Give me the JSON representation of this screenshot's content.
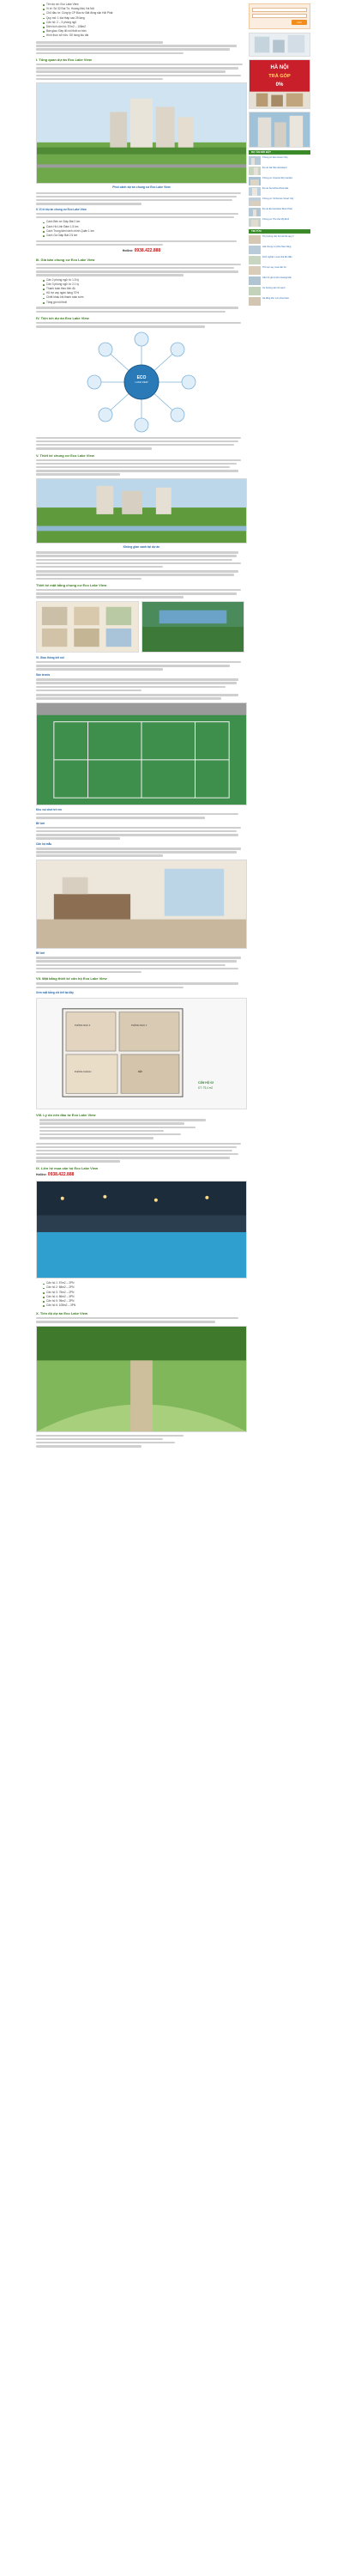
{
  "intro_list": [
    "Tên dự án: Eco Lake View",
    "Vị trí: Số 32 Đại Từ, Hoàng Mai, Hà Nội",
    "Chủ đầu tư: Công ty CP Đầu tư Bất động sản Hải Phát",
    "Quy mô: 1 tòa tháp cao 25 tầng",
    "Căn hộ: 2 – 3 phòng ngủ",
    "Diện tích căn hộ: 57m2 – 108m2",
    "Bàn giao: Đầy đủ nội thất cơ bản",
    "Hình thức sở hữu: Sổ hồng lâu dài"
  ],
  "sec_overview_title": "I. Tổng quan dự án Eco Lake View",
  "img1_caption": "Phối cảnh dự án chung cư Eco Lake View",
  "sec_location_title": "II. Vị trí dự án chung cư Eco Lake View",
  "location_list": [
    "Cách Bến xe Giáp Bát 2 km",
    "Cách Hồ Linh Đàm 1.5 km",
    "Cách Trung tâm hành chính Quận 1 km",
    "Cách Ga Giáp Bát 2.5 km"
  ],
  "hotline": {
    "label": "Hotline:",
    "number": "0938.422.888"
  },
  "sec_price_title": "III. Giá bán chung cư Eco Lake View",
  "price_list": [
    "Căn 2 phòng ngủ: từ 1.5 tỷ",
    "Căn 3 phòng ngủ: từ 2.1 tỷ",
    "Thanh toán theo tiến độ",
    "Hỗ trợ vay ngân hàng 70%",
    "Chiết khấu khi thanh toán sớm",
    "Tặng gói nội thất"
  ],
  "sec_utility_title": "IV. Tiện ích dự án Eco Lake View",
  "eco_center": "ECO",
  "eco_center2": "LAKE VIEW",
  "sec_design_title": "V. Thiết kế chung cư Eco Lake View",
  "img2_caption": "Không gian xanh tại dự án",
  "sec_ground_title": "Thiết kế mặt bằng chung cư Eco Lake View",
  "sec_transport_title": "VI. Giao thông kết nối",
  "sec_park_title": "Sân tennis",
  "sec_kids_title": "Khu vui chơi trẻ em",
  "sec_pool_title": "Bể bơi",
  "sec_home_title": "Căn hộ mẫu",
  "sec_plan_title": "VII. Mặt bằng thiết kế căn hộ Eco Lake View",
  "plan_link": "Xem mặt bằng chi tiết tại đây",
  "plan_tags": [
    "PHÒNG NGỦ 2",
    "PHÒNG NGỦ 1",
    "PHÒNG KHÁCH",
    "BẾP"
  ],
  "plan_area": "DT: 75,4 m2",
  "plan_room": "CĂN HỘ 02",
  "sec_reason_title": "VIII. Lý do nên đầu tư Eco Lake View",
  "sec_contact_title": "IX. Liên hệ mua căn hộ Eco Lake View",
  "final_list": [
    "Căn hộ 1: 57m2 – 2PN",
    "Căn hộ 2: 68m2 – 2PN",
    "Căn hộ 3: 75m2 – 2PN",
    "Căn hộ 4: 86m2 – 3PN",
    "Căn hộ 5: 95m2 – 3PN",
    "Căn hộ 6: 108m2 – 3PN"
  ],
  "sec_last_title": "X. Tiến độ dự án Eco Lake View",
  "sidebar": {
    "form_button": "Gửi",
    "banner_hn": "HÀ NỘI",
    "banner_tg": "TRẢ GÓP",
    "banner_pct": "0%",
    "list_head": "DỰ ÁN NỔI BẬT",
    "list_head2": "TIN TỨC",
    "items": [
      "Chung cư Eco Green City",
      "Dự án Hà Nội Homeland",
      "Chung cư Imperia Sky Garden",
      "Dự án Sunshine Riverside",
      "Chung cư Vinhomes Smart City",
      "Dự án Eurowindow River Park",
      "Chung cư The Zei Mỹ Đình"
    ],
    "news": [
      "Thị trường căn hộ Hà Nội quý 3",
      "Giá chung cư phía Nam tăng",
      "Kinh nghiệm mua nhà lần đầu",
      "Thủ tục vay mua căn hộ",
      "Căn hộ giá rẻ khu Hoàng Mai",
      "Xu hướng căn hộ xanh",
      "Hạ tầng khu vực phía Nam"
    ]
  },
  "colors": {
    "accent_green": "#3a7a1e",
    "link_blue": "#2a6aa8",
    "hotline_red": "#d01010",
    "button_orange": "#f28c1b"
  }
}
